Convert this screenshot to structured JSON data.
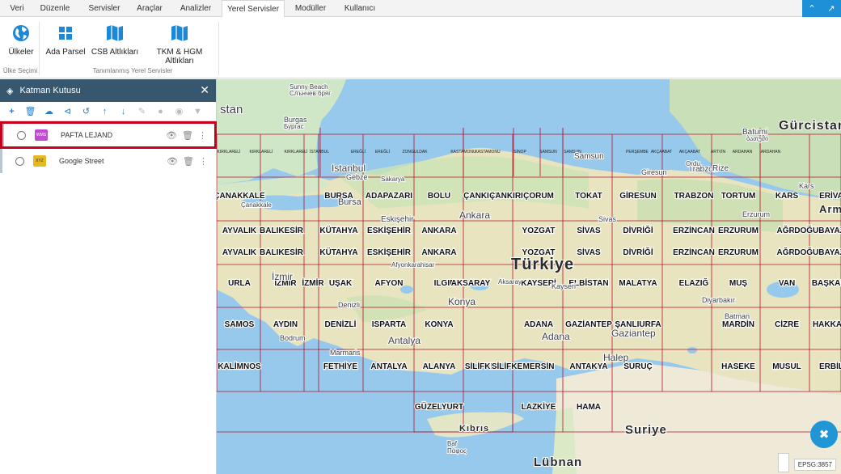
{
  "menu": {
    "tabs": [
      {
        "label": "Veri"
      },
      {
        "label": "Düzenle"
      },
      {
        "label": "Servisler"
      },
      {
        "label": "Araçlar"
      },
      {
        "label": "Analizler"
      },
      {
        "label": "Yerel Servisler",
        "active": true
      },
      {
        "label": "Modüller"
      },
      {
        "label": "Kullanıcı"
      }
    ]
  },
  "ribbon": {
    "buttons": [
      {
        "label": "Ülkeler",
        "icon": "globe-icon"
      },
      {
        "label": "Ada Parsel",
        "icon": "grid-icon"
      },
      {
        "label": "CSB Altlıkları",
        "icon": "map-icon"
      },
      {
        "label": "TKM & HGM Altlıkları",
        "icon": "map-icon"
      }
    ],
    "groups": [
      {
        "label": "Ülke Seçimi"
      },
      {
        "label": "Tanımlanmış Yerel Servisler"
      }
    ]
  },
  "panel": {
    "title": "Katman Kutusu",
    "layers": [
      {
        "name": "PAFTA LEJAND",
        "badge": "WMS",
        "badge_color": "#c04ad0",
        "selected": true
      },
      {
        "name": "Google Street",
        "badge": "XYZ",
        "badge_color": "#e8b820",
        "selected": false
      }
    ]
  },
  "map": {
    "epsg": "EPSG:3857",
    "countries": [
      "Türkiye",
      "Gürcistan",
      "Suriye",
      "Lübnan",
      "Kıbrıs",
      "Arm"
    ],
    "cities": [
      "Sunny Beach",
      "Слънчев бряг",
      "Burgas",
      "Бургас",
      "Istanbul",
      "Gebze",
      "Bursa",
      "Sakarya",
      "Eskişehir",
      "Ankara",
      "İzmir",
      "Denizli",
      "Konya",
      "Antalya",
      "Adana",
      "Gaziantep",
      "Halep",
      "Batumi",
      "ბათუმი",
      "Trabzon",
      "Rize",
      "Giresun",
      "Samsun",
      "Sivas",
      "Erzurum",
      "Kars",
      "Diyarbakır",
      "Batman",
      "Bodrum",
      "Marmaris",
      "Afyonkarahisar",
      "Aksaray",
      "Çanakkale",
      "Baf",
      "Πάφος",
      "Ordu",
      "Kayseri",
      "stan"
    ],
    "sheets": [
      "ÇANAKKALE",
      "BURSA",
      "ADAPAZARI",
      "BOLU",
      "ÇANKIRI",
      "ÇANKIRI",
      "ÇORUM",
      "TOKAT",
      "GİRESUN",
      "TRABZON",
      "TORTUM",
      "KARS",
      "ERİVA",
      "AYVALIK",
      "BALIKESİR",
      "KÜTAHYA",
      "ESKİŞEHİR",
      "ANKARA",
      "YOZGAT",
      "SİVAS",
      "DİVRİĞİ",
      "ERZİNCAN",
      "ERZURUM",
      "AĞRI",
      "DOĞUBAYAZIT",
      "AYVALIK",
      "BALIKESİR",
      "KÜTAHYA",
      "ESKİŞEHİR",
      "ANKARA",
      "YOZGAT",
      "SİVAS",
      "DİVRİĞİ",
      "ERZİNCAN",
      "ERZURUM",
      "AĞRI",
      "DOĞUBAYAZIT",
      "URLA",
      "İZMİR",
      "İZMİR",
      "UŞAK",
      "AFYON",
      "ILGIN",
      "AKSARAY",
      "KAYSERİ",
      "ELBİSTAN",
      "MALATYA",
      "ELAZIĞ",
      "MUŞ",
      "VAN",
      "BAŞKALE",
      "SAMOS",
      "AYDIN",
      "DENİZLİ",
      "ISPARTA",
      "KONYA",
      "ADANA",
      "GAZİANTEP",
      "ŞANLIURFA",
      "MARDİN",
      "CİZRE",
      "HAKKARİ",
      "KALİMNOS",
      "FETHİYE",
      "ANTALYA",
      "ALANYA",
      "SİLİFKE",
      "SİLİFKE",
      "MERSİN",
      "ANTAKYA",
      "SURUÇ",
      "HASEKE",
      "MUSUL",
      "ERBİL",
      "GÜZELYURT",
      "LAZKİYE",
      "HAMA"
    ],
    "small_sheets": [
      "KIRKLARELİ",
      "KIRKLARELİ",
      "KIRKLARELİ",
      "İSTANBUL",
      "EREĞLİ",
      "EREĞLİ",
      "ZONGULDAK",
      "KASTAMONU",
      "KASTAMONU",
      "SİNOP",
      "SAMSUN",
      "SAMSUN",
      "PERŞEMBE",
      "AKÇAABAT",
      "AKÇAABAT",
      "ARTVİN",
      "ARDAHAN",
      "ARDAHAN"
    ]
  }
}
